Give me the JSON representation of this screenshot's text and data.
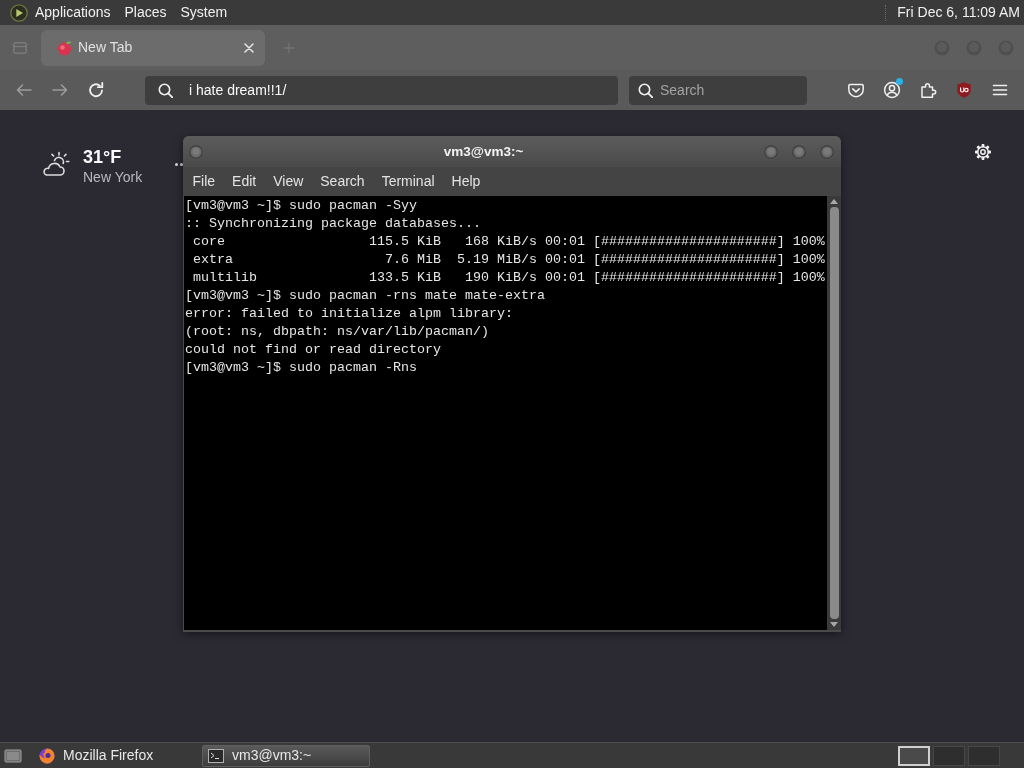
{
  "top_panel": {
    "menus": [
      "Applications",
      "Places",
      "System"
    ],
    "clock": "Fri Dec 6, 11:09 AM"
  },
  "browser": {
    "tabs": [
      {
        "title": "New Tab",
        "selected": true
      }
    ],
    "nav_buttons": [
      {
        "kind": "back",
        "disabled": true
      },
      {
        "kind": "forward",
        "disabled": true
      },
      {
        "kind": "reload",
        "disabled": false
      }
    ],
    "address_bar": {
      "value": "i hate dream!!1/"
    },
    "search_field": {
      "placeholder": "Search"
    },
    "toolbar_icons": [
      {
        "kind": "save",
        "notification": false
      },
      {
        "kind": "account",
        "notification": true
      },
      {
        "kind": "extensions",
        "notification": false
      },
      {
        "kind": "blocker",
        "notification": false
      },
      {
        "kind": "menu",
        "notification": false
      }
    ],
    "weather": {
      "temperature": "31°F",
      "location": "New York"
    }
  },
  "terminal": {
    "title": "vm3@vm3:~",
    "menu": [
      "File",
      "Edit",
      "View",
      "Search",
      "Terminal",
      "Help"
    ],
    "lines": [
      "[vm3@vm3 ~]$ sudo pacman -Syy",
      ":: Synchronizing package databases...",
      " core                  115.5 KiB   168 KiB/s 00:01 [######################] 100%",
      " extra                   7.6 MiB  5.19 MiB/s 00:01 [######################] 100%",
      " multilib              133.5 KiB   190 KiB/s 00:01 [######################] 100%",
      "[vm3@vm3 ~]$ sudo pacman -rns mate mate-extra",
      "error: failed to initialize alpm library:",
      "(root: ns, dbpath: ns/var/lib/pacman/)",
      "could not find or read directory",
      "[vm3@vm3 ~]$ sudo pacman -Rns"
    ]
  },
  "taskbar": {
    "items": [
      {
        "kind": "browser",
        "label": "Mozilla Firefox",
        "selected": false
      },
      {
        "kind": "terminal",
        "label": "vm3@vm3:~",
        "selected": true
      }
    ],
    "workspaces": [
      {
        "selected": true
      },
      {
        "selected": false
      },
      {
        "selected": false
      }
    ]
  }
}
